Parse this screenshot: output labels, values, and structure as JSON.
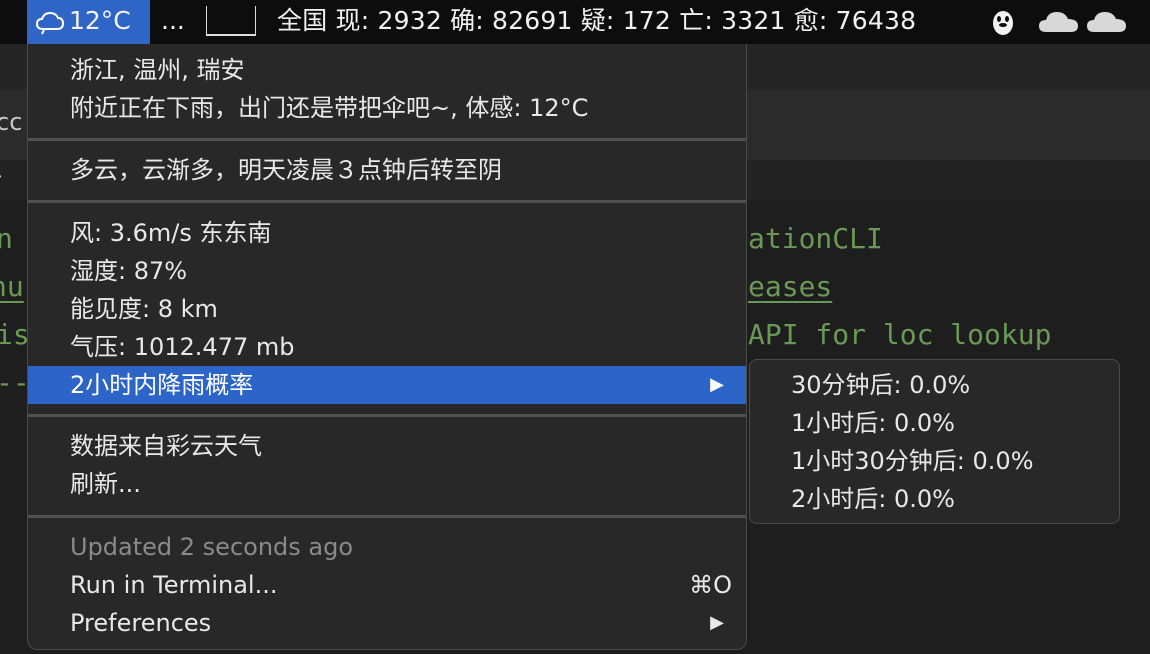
{
  "menubar": {
    "weather_temp": "12°C",
    "overflow_dots": "...",
    "covid_stats": "全国 现: 2932 确: 82691 疑: 172 亡: 3321 愈: 76438"
  },
  "editor": {
    "left_fragments": [
      "cc",
      "n",
      "nu",
      "is",
      "--"
    ],
    "right_fragments": [
      "ationCLI",
      "eases",
      "API for loc lookup"
    ]
  },
  "menu": {
    "location": "浙江, 温州, 瑞安",
    "now_summary": "附近正在下雨，出门还是带把伞吧~, 体感: 12°C",
    "forecast": "多云，云渐多，明天凌晨３点钟后转至阴",
    "wind": "风: 3.6m/s 东东南",
    "humidity": "湿度: 87%",
    "visibility": "能见度: 8 km",
    "pressure": "气压: 1012.477 mb",
    "rain_prob_label": "2小时内降雨概率",
    "source": "数据来自彩云天气",
    "refresh": "刷新...",
    "updated": "Updated 2 seconds ago",
    "run_terminal": "Run in Terminal...",
    "run_terminal_shortcut": "⌘O",
    "preferences": "Preferences",
    "submenu_arrow": "▶"
  },
  "submenu": {
    "items": [
      "30分钟后: 0.0%",
      "1小时后: 0.0%",
      "1小时30分钟后: 0.0%",
      "2小时后: 0.0%"
    ]
  },
  "colors": {
    "highlight": "#2c64c7",
    "menubar_active": "#3065c8",
    "menu_bg": "#282828",
    "code_green": "#6a9955"
  }
}
